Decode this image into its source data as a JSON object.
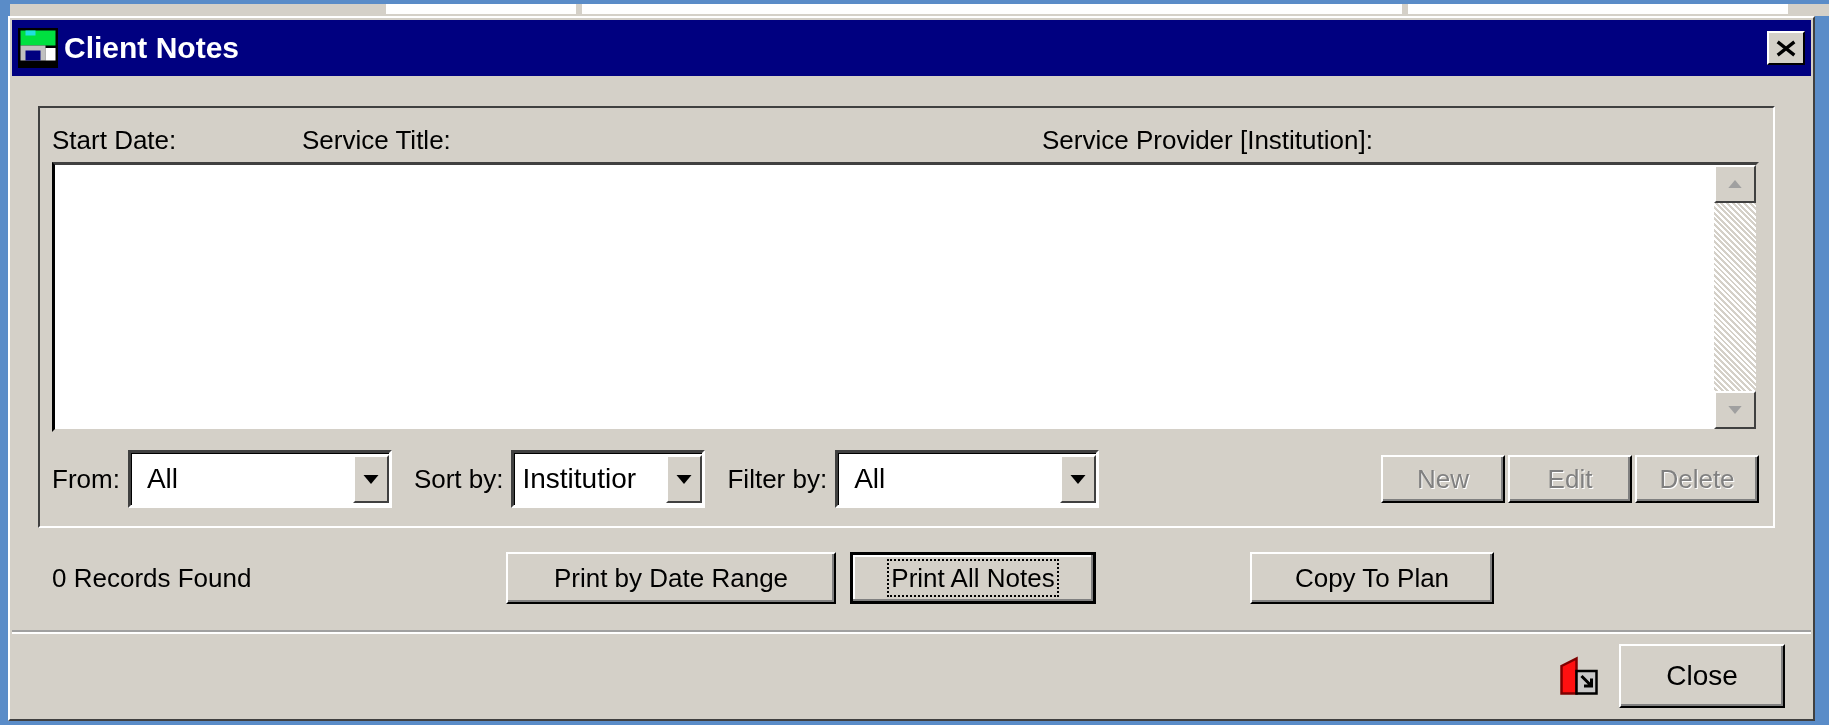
{
  "window": {
    "title": "Client Notes"
  },
  "list": {
    "columns": [
      "Start Date:",
      "Service Title:",
      "Service Provider [Institution]:"
    ]
  },
  "filters": [
    {
      "label": "From:",
      "value": "All"
    },
    {
      "label": "Sort by:",
      "value": "Institutior"
    },
    {
      "label": "Filter by:",
      "value": "All"
    }
  ],
  "record_buttons": [
    {
      "label": "New",
      "disabled": true
    },
    {
      "label": "Edit",
      "disabled": true
    },
    {
      "label": "Delete",
      "disabled": true
    }
  ],
  "status": "0 Records Found",
  "actions": [
    {
      "label": "Print by Date Range",
      "focused": false
    },
    {
      "label": "Print All Notes",
      "focused": true
    },
    {
      "label": "Copy To Plan",
      "focused": false
    }
  ],
  "close_button": {
    "label": "Close"
  }
}
